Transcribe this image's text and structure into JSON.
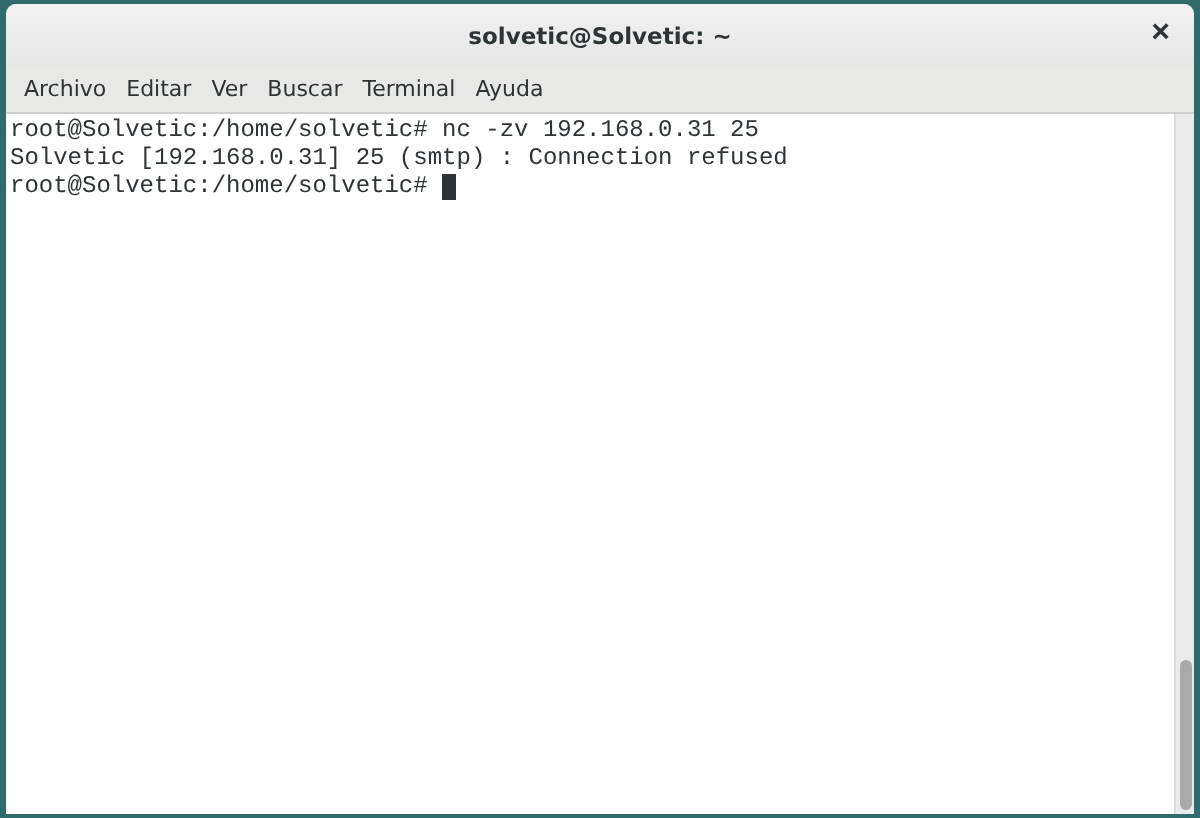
{
  "window": {
    "title": "solvetic@Solvetic: ~",
    "close": "×"
  },
  "menu": [
    "Archivo",
    "Editar",
    "Ver",
    "Buscar",
    "Terminal",
    "Ayuda"
  ],
  "terminal": {
    "lines": [
      "root@Solvetic:/home/solvetic# nc -zv 192.168.0.31 25",
      "Solvetic [192.168.0.31] 25 (smtp) : Connection refused",
      "root@Solvetic:/home/solvetic# "
    ],
    "cursor": true
  }
}
